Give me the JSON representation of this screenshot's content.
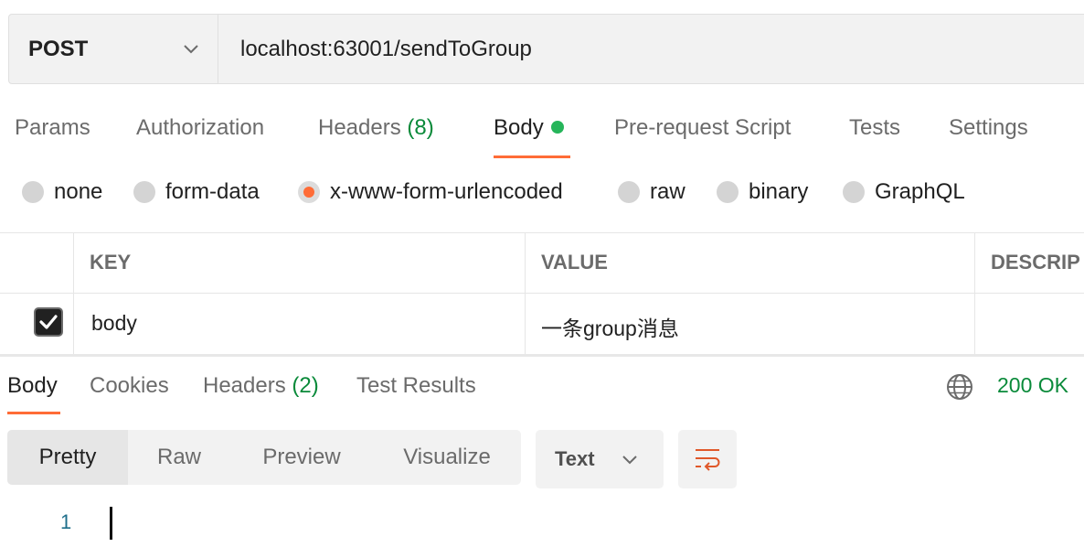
{
  "request": {
    "method": "POST",
    "url": "localhost:63001/sendToGroup"
  },
  "request_tabs": [
    {
      "label": "Params"
    },
    {
      "label": "Authorization"
    },
    {
      "label": "Headers",
      "count": "(8)"
    },
    {
      "label": "Body",
      "active": true,
      "has_dot": true
    },
    {
      "label": "Pre-request Script"
    },
    {
      "label": "Tests"
    },
    {
      "label": "Settings"
    }
  ],
  "body_types": [
    {
      "label": "none"
    },
    {
      "label": "form-data"
    },
    {
      "label": "x-www-form-urlencoded",
      "selected": true
    },
    {
      "label": "raw"
    },
    {
      "label": "binary"
    },
    {
      "label": "GraphQL"
    }
  ],
  "params_table": {
    "headers": [
      "KEY",
      "VALUE",
      "DESCRIP"
    ],
    "rows": [
      {
        "checked": true,
        "key": "body",
        "value": "一条group消息",
        "description": ""
      }
    ]
  },
  "response_tabs": [
    {
      "label": "Body",
      "active": true
    },
    {
      "label": "Cookies"
    },
    {
      "label": "Headers",
      "count": "(2)"
    },
    {
      "label": "Test Results"
    }
  ],
  "response_status": "200 OK",
  "view_modes": [
    {
      "label": "Pretty",
      "active": true
    },
    {
      "label": "Raw"
    },
    {
      "label": "Preview"
    },
    {
      "label": "Visualize"
    }
  ],
  "format": "Text",
  "editor": {
    "line_numbers": [
      "1"
    ]
  },
  "colors": {
    "accent": "#ff6c37",
    "success": "#0a8a3a",
    "dot_green": "#26b55a"
  },
  "icons": {
    "method_dropdown": "chevron-down-icon",
    "globe": "globe-icon",
    "format_dropdown": "chevron-down-icon",
    "wrap": "wrap-lines-icon",
    "checkbox": "check-icon"
  }
}
